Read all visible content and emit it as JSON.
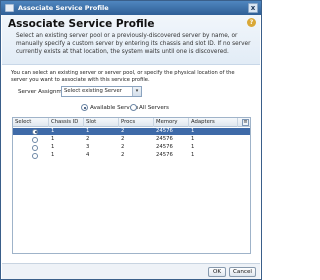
{
  "window": {
    "title": "Associate Service Profile",
    "close_glyph": "x"
  },
  "header": {
    "title": "Associate Service Profile",
    "help_glyph": "?",
    "description": "Select an existing server pool or a previously-discovered server by name, or manually specify a custom server by entering its chassis and slot ID. If no server currently exists at that location, the system waits until one is discovered."
  },
  "body": {
    "description": "You can select an existing server or server pool, or specify the physical location of the server you want to associate with this service profile.",
    "server_assignment": {
      "label": "Server Assignment:",
      "value": "Select existing Server",
      "arrow": "▾"
    },
    "filters": [
      {
        "label": "Available Servers",
        "selected": true
      },
      {
        "label": "All Servers",
        "selected": false
      }
    ]
  },
  "grid": {
    "columns": [
      "Select",
      "Chassis ID",
      "Slot",
      "Procs",
      "Memory",
      "Adapters"
    ],
    "column_options_glyph": "≡",
    "rows": [
      {
        "chassis": "1",
        "slot": "1",
        "procs": "2",
        "memory": "24576",
        "adapters": "1",
        "selected": true
      },
      {
        "chassis": "1",
        "slot": "2",
        "procs": "2",
        "memory": "24576",
        "adapters": "1",
        "selected": false
      },
      {
        "chassis": "1",
        "slot": "3",
        "procs": "2",
        "memory": "24576",
        "adapters": "1",
        "selected": false
      },
      {
        "chassis": "1",
        "slot": "4",
        "procs": "2",
        "memory": "24576",
        "adapters": "1",
        "selected": false
      }
    ]
  },
  "footer": {
    "ok_label": "OK",
    "cancel_label": "Cancel"
  },
  "colors": {
    "title_bar": "#2f5f96",
    "selected_row": "#3e6aa8",
    "help_icon": "#d9a838"
  }
}
